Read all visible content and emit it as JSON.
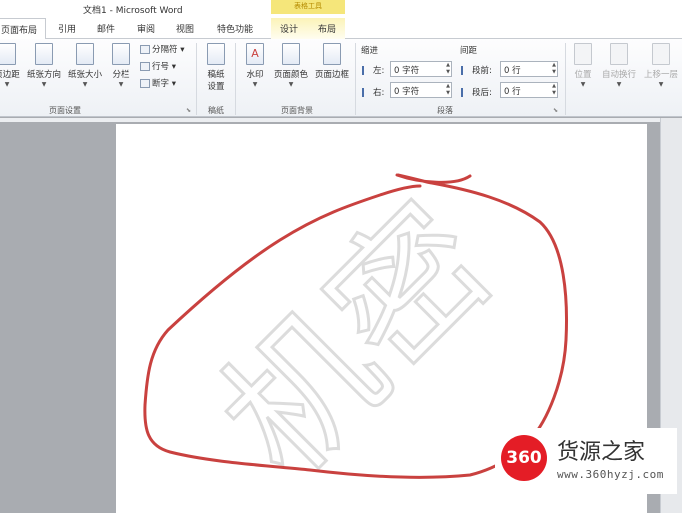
{
  "window": {
    "title": "文档1 - Microsoft Word"
  },
  "context_tab_group": "表格工具",
  "tabs": [
    {
      "label": "页面布局"
    },
    {
      "label": "引用"
    },
    {
      "label": "邮件"
    },
    {
      "label": "审阅"
    },
    {
      "label": "视图"
    },
    {
      "label": "特色功能"
    },
    {
      "label": "设计"
    },
    {
      "label": "布局"
    }
  ],
  "ribbon": {
    "page_setup": {
      "label": "页面设置",
      "margins": "页边距",
      "orientation": "纸张方向",
      "size": "纸张大小",
      "columns": "分栏",
      "breaks": "分隔符",
      "line_numbers": "行号",
      "hyphenation": "断字"
    },
    "manuscript": {
      "label": "稿纸",
      "setup_line1": "稿纸",
      "setup_line2": "设置"
    },
    "page_background": {
      "label": "页面背景",
      "watermark": "水印",
      "page_color": "页面颜色",
      "page_borders": "页面边框"
    },
    "paragraph": {
      "label": "段落",
      "indent_title": "缩进",
      "spacing_title": "间距",
      "indent_left_label": "左:",
      "indent_left_value": "0 字符",
      "indent_right_label": "右:",
      "indent_right_value": "0 字符",
      "spacing_before_label": "段前:",
      "spacing_before_value": "0 行",
      "spacing_after_label": "段后:",
      "spacing_after_value": "0 行"
    },
    "arrange": {
      "position": "位置",
      "wrap_text": "自动换行",
      "bring_forward": "上移一层"
    }
  },
  "document": {
    "watermark_text": "机密"
  },
  "annotation": {
    "color": "#c9413f"
  },
  "logo": {
    "badge": "360",
    "name": "货源之家",
    "url": "www.360hyzj.com"
  }
}
